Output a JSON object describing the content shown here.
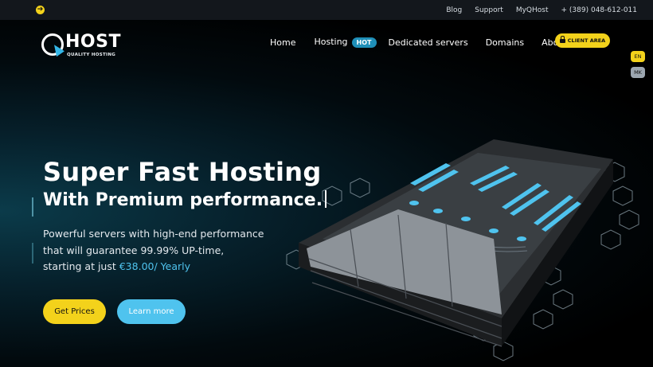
{
  "topbar": {
    "links": [
      "Blog",
      "Support",
      "MyQHost",
      "+ (389) 048-612-011"
    ]
  },
  "logo": {
    "brand": "HOST",
    "tagline": "QUALITY HOSTING"
  },
  "nav": {
    "items": [
      "Home",
      "Hosting",
      "Dedicated servers",
      "Domains",
      "About us"
    ],
    "hot_badge": "HOT",
    "client_area": "CLIENT AREA"
  },
  "languages": [
    "EN",
    "MK"
  ],
  "hero": {
    "headline": "Super Fast Hosting",
    "subheadline": "With Premium performance.",
    "description_line1": "Powerful servers with high-end performance",
    "description_line2": "that will guarantee 99.99% UP-time,",
    "description_prefix": "starting at just ",
    "price": "€38.00/ Yearly",
    "btn_prices": "Get Prices",
    "btn_learn": "Learn more"
  },
  "colors": {
    "accent_yellow": "#f3d21b",
    "accent_blue": "#4fc3ee",
    "topbar_bg": "#13171c"
  }
}
